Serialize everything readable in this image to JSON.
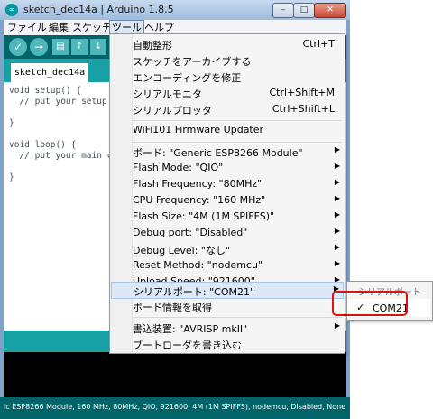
{
  "window": {
    "title": "sketch_dec14a | Arduino 1.8.5",
    "app_icon": "arduino-logo-icon",
    "controls": {
      "minimize": "–",
      "maximize": "□",
      "close": "✕"
    }
  },
  "menubar": {
    "items": [
      "ファイル",
      "編集",
      "スケッチ",
      "ツール",
      "ヘルプ"
    ],
    "active": "ツール"
  },
  "toolbar": {
    "verify_icon": "✓",
    "upload_icon": "→",
    "new_icon": "▤",
    "open_icon": "↑",
    "save_icon": "↓"
  },
  "tabs": [
    {
      "label": "sketch_dec14a"
    }
  ],
  "editor": {
    "lines": [
      "void setup() {",
      "  // put your setup code",
      "",
      "}",
      "",
      "void loop() {",
      "  // put your main code",
      "",
      "}"
    ]
  },
  "tools_menu": {
    "items": [
      {
        "label": "自動整形",
        "shortcut": "Ctrl+T"
      },
      {
        "label": "スケッチをアーカイブする",
        "shortcut": ""
      },
      {
        "label": "エンコーディングを修正",
        "shortcut": ""
      },
      {
        "label": "シリアルモニタ",
        "shortcut": "Ctrl+Shift+M"
      },
      {
        "label": "シリアルプロッタ",
        "shortcut": "Ctrl+Shift+L"
      },
      {
        "label": "WiFi101 Firmware Updater",
        "shortcut": ""
      },
      {
        "label": "ボード: \"Generic ESP8266 Module\"",
        "submenu": true
      },
      {
        "label": "Flash Mode: \"QIO\"",
        "submenu": true
      },
      {
        "label": "Flash Frequency: \"80MHz\"",
        "submenu": true
      },
      {
        "label": "CPU Frequency: \"160 MHz\"",
        "submenu": true
      },
      {
        "label": "Flash Size: \"4M (1M SPIFFS)\"",
        "submenu": true
      },
      {
        "label": "Debug port: \"Disabled\"",
        "submenu": true
      },
      {
        "label": "Debug Level: \"なし\"",
        "submenu": true
      },
      {
        "label": "Reset Method: \"nodemcu\"",
        "submenu": true
      },
      {
        "label": "Upload Speed: \"921600\"",
        "submenu": true
      },
      {
        "label": "シリアルポート: \"COM21\"",
        "submenu": true,
        "highlighted": true
      },
      {
        "label": "ボード情報を取得",
        "submenu": false
      },
      {
        "label": "書込装置: \"AVRISP mkII\"",
        "submenu": true
      },
      {
        "label": "ブートローダを書き込む",
        "submenu": false
      }
    ]
  },
  "serial_port_submenu": {
    "header": "シリアルポート",
    "items": [
      {
        "label": "COM21",
        "checked": true,
        "check_mark": "✓"
      }
    ]
  },
  "status_footer": {
    "text": "ic ESP8266 Module, 160 MHz, 80MHz, QIO, 921600, 4M (1M SPIFFS), nodemcu, Disabled, None"
  },
  "colors": {
    "arduino_teal_dark": "#006468",
    "arduino_teal": "#17a1a5",
    "menu_highlight": "#dce8f7",
    "annotation_red": "#e01010"
  }
}
